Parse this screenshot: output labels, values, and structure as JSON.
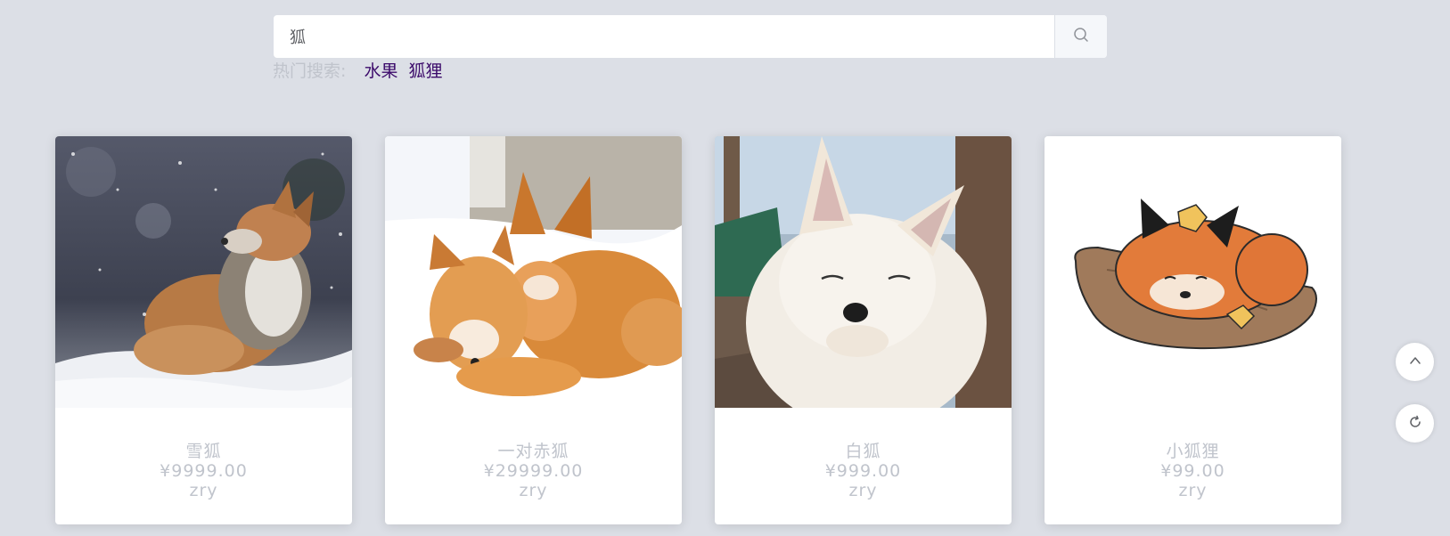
{
  "search": {
    "value": "狐",
    "placeholder": ""
  },
  "hot_search": {
    "label": "热门搜索:",
    "links": [
      "水果",
      "狐狸"
    ]
  },
  "products": [
    {
      "name": "雪狐",
      "price": "¥9999.00",
      "seller": "zry"
    },
    {
      "name": "一对赤狐",
      "price": "¥29999.00",
      "seller": "zry"
    },
    {
      "name": "白狐",
      "price": "¥999.00",
      "seller": "zry"
    },
    {
      "name": "小狐狸",
      "price": "¥99.00",
      "seller": "zry"
    }
  ],
  "icons": {
    "search": "search-icon",
    "back_to_top": "chevron-up-icon",
    "refresh": "refresh-icon"
  },
  "colors": {
    "background": "#dcdfe6",
    "hot_link": "#3b0a6a",
    "muted_text": "#c0c4cc"
  }
}
